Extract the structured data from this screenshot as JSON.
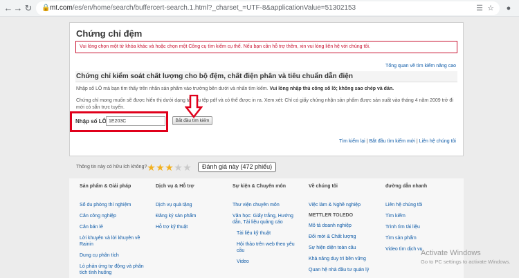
{
  "browser": {
    "url_host": "mt.com",
    "url_rest": "/es/en/home/search/buffercert-search.1.html?_charset_=UTF-8&applicationValue=51302153",
    "icons": [
      "back-arrow-icon",
      "forward-arrow-icon",
      "reload-icon",
      "lock-icon",
      "translate-icon",
      "star-icon",
      "profile-icon"
    ]
  },
  "page": {
    "title": "Chứng chỉ đệm",
    "alert": "Vui lòng chọn một từ khóa khác và hoặc chọn một Công cụ tìm kiếm cụ thể. Nếu bạn cần hỗ trợ thêm, xin vui lòng liên hệ với chúng tôi.",
    "overview_link": "Tổng quan về tìm kiếm nâng cao",
    "section_title": "Chứng chỉ kiểm soát chất lượng cho bộ đệm, chất điện phân và tiêu chuẩn dẫn điện",
    "instruction_plain": "Nhập số LÔ mà bạn tìm thấy trên nhãn sản phẩm vào trường bên dưới và nhấn tìm kiếm. ",
    "instruction_bold": "Vui lòng nhập thủ công số lô; không sao chép và dán.",
    "info_text": "Chứng chỉ mong muốn sẽ được hiển thị dưới dạng tài liệu tệp pdf và có thể được in ra. Xem xét: Chỉ có giấy chứng nhận sản phẩm được sản xuất vào tháng 4 năm 2009 trở đi mới có sẵn trực tuyến.",
    "lot_label": "Nhập số LÔ:",
    "lot_value": "1E203C",
    "search_button": "Bắt đầu tìm kiếm",
    "bottom_links": [
      "Tìm kiếm lại",
      "Bắt đầu tìm kiếm mới",
      "Liên hệ chúng tôi"
    ],
    "separator": "|"
  },
  "rating": {
    "question": "Thông tin này có hữu ích không?",
    "stars_filled": 3,
    "stars_total": 5,
    "badge": "Đánh giá này (472 phiếu)",
    "colors": {
      "on": "#f2b01e",
      "off": "#c9c9c9"
    }
  },
  "footer": {
    "columns": [
      {
        "title": "Sản phẩm & Giải pháp",
        "links": [
          "Sổ du phòng thí nghiệm",
          "Cân công nghiệp",
          "Cân bán lẻ",
          "Lời khuyên và lời khuyên về Rainin",
          "Dung cụ phân tích",
          "Lò phản ứng tự động và phân tích tình huống"
        ]
      },
      {
        "title": "Dịch vụ & Hỗ trợ",
        "links": [
          "Dịch vụ quà tặng",
          "Đăng ký sản phẩm",
          "Hỗ trợ kỹ thuật"
        ]
      },
      {
        "title": "Sự kiện & Chuyên môn",
        "links": [
          "Thư viện chuyên môn",
          "Văn học: Giấy trắng, Hướng dẫn, Tài liệu quảng cáo",
          "Tài liệu kỹ thuật",
          "Hội thảo trên web theo yêu cầu",
          "Video"
        ]
      },
      {
        "title": "Về chúng tôi",
        "links": [
          "Việc làm & Nghề nghiệp"
        ],
        "subtitle": "METTLER TOLEDO",
        "sublinks": [
          "Mô tả doanh nghiệp",
          "Đổi mới & Chất lượng",
          "Sự hiện diện toàn cầu",
          "Khả năng duy trì bền vững",
          "Quan hệ nhà đầu tư quản lý"
        ]
      },
      {
        "title": "đường dẫn nhanh",
        "links": [
          "Liên hệ chúng tôi",
          "Tìm kiếm",
          "Trình tìm tài liệu",
          "Tìm sản phẩm",
          "Video tìm dịch vụ"
        ]
      }
    ]
  },
  "watermark": {
    "line1": "Activate Windows",
    "line2": "Go to PC settings to activate Windows."
  },
  "colors": {
    "accent_red": "#e0001b",
    "link_blue": "#0d5aa7"
  }
}
